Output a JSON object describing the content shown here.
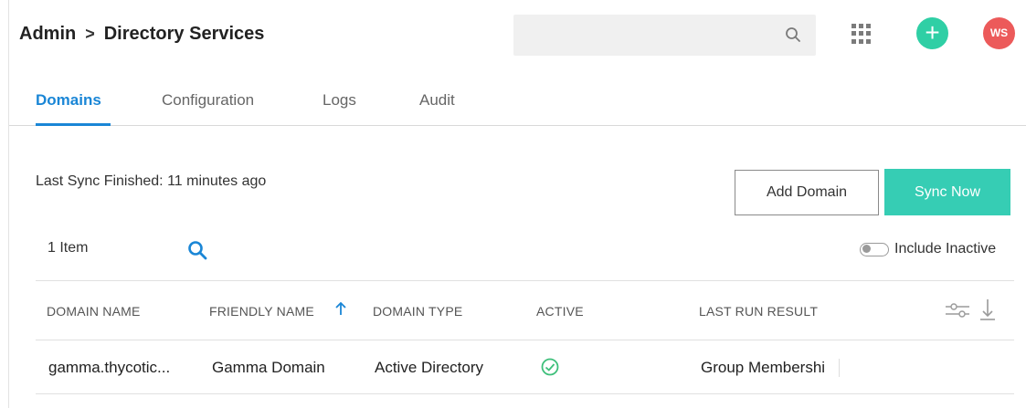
{
  "breadcrumb": {
    "root": "Admin",
    "separator": ">",
    "current": "Directory Services"
  },
  "search": {
    "value": "",
    "placeholder": "",
    "icon": "search-icon"
  },
  "header_actions": {
    "apps_icon": "grid-icon",
    "add_icon": "plus-icon",
    "add_glyph": "+",
    "avatar_initials": "WS"
  },
  "tabs": [
    {
      "label": "Domains",
      "active": true
    },
    {
      "label": "Configuration",
      "active": false
    },
    {
      "label": "Logs",
      "active": false
    },
    {
      "label": "Audit",
      "active": false
    }
  ],
  "sync": {
    "status": "Last Sync Finished: 11 minutes ago",
    "add_domain_label": "Add Domain",
    "sync_now_label": "Sync Now"
  },
  "list": {
    "item_count": "1 Item",
    "include_inactive_label": "Include Inactive",
    "include_inactive_checked": false
  },
  "table": {
    "columns": [
      "DOMAIN NAME",
      "FRIENDLY NAME",
      "DOMAIN TYPE",
      "ACTIVE",
      "LAST RUN RESULT"
    ],
    "sort_column": "FRIENDLY NAME",
    "sort_direction": "ascending",
    "rows": [
      {
        "domain_name": "gamma.thycotic...",
        "friendly_name": "Gamma Domain",
        "domain_type": "Active Directory",
        "active": true,
        "last_run_result": "Group Membershi"
      }
    ]
  },
  "colors": {
    "accent": "#1a86d6",
    "sync_button": "#36cdb4",
    "add_button": "#2fcfa5",
    "avatar": "#ec5a5a",
    "active_check": "#3dbf7a"
  }
}
